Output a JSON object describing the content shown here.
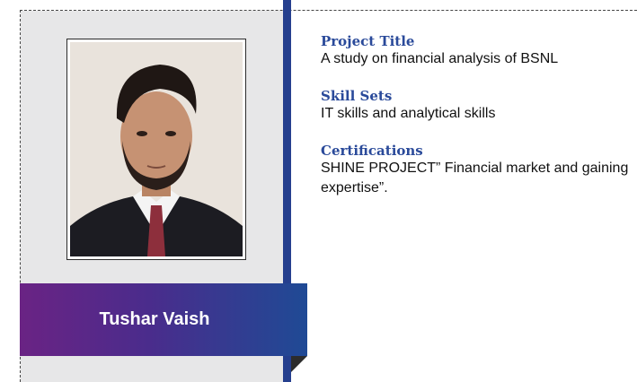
{
  "profile": {
    "name": "Tushar Vaish",
    "photo_alt": "portrait photo"
  },
  "sections": [
    {
      "heading": "Project Title",
      "text": "A study on financial analysis of BSNL"
    },
    {
      "heading": "Skill Sets",
      "text": "IT skills and analytical skills"
    },
    {
      "heading": "Certifications",
      "text": "SHINE PROJECT” Financial market and gaining expertise”."
    }
  ],
  "colors": {
    "panel": "#e7e7e8",
    "accent_blue": "#253f8e",
    "heading": "#2a4a9a",
    "gradient_start": "#6a2384",
    "gradient_end": "#1f4a95"
  }
}
